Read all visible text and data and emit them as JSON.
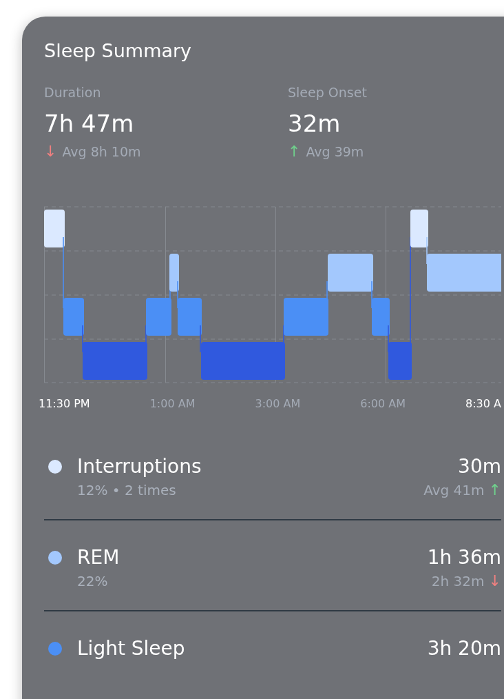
{
  "card": {
    "title": "Sleep Summary"
  },
  "stats": [
    {
      "label": "Duration",
      "value": "7h 47m",
      "arrow": "↓",
      "improved": false,
      "average": "Avg 8h 10m"
    },
    {
      "label": "Sleep Onset",
      "value": "32m",
      "arrow": "↑",
      "improved": true,
      "average": "Avg 39m"
    }
  ],
  "time_axis": [
    {
      "label": "11:30 PM",
      "highlighted": true
    },
    {
      "label": "1:00 AM",
      "highlighted": false
    },
    {
      "label": "3:00 AM",
      "highlighted": false
    },
    {
      "label": "6:00 AM",
      "highlighted": false
    },
    {
      "label": "8:30 A",
      "highlighted": true
    }
  ],
  "stages": [
    {
      "name": "Interruptions",
      "color": "#dbe9ff",
      "value": "30m",
      "detail": "12% • 2 times",
      "comparison": "Avg 41m",
      "arrow": "↑",
      "improved": true
    },
    {
      "name": "REM",
      "color": "#a3c8fd",
      "value": "1h 36m",
      "detail": "22%",
      "comparison": "2h 32m",
      "arrow": "↓",
      "improved": false
    },
    {
      "name": "Light Sleep",
      "color": "#4b8ff5",
      "value": "3h 20m"
    }
  ]
}
